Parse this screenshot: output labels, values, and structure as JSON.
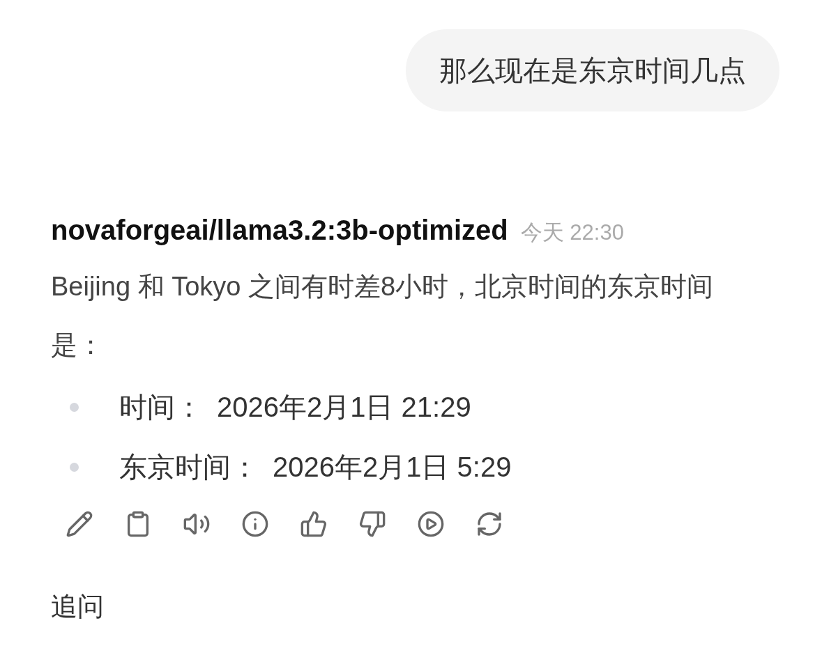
{
  "user_message": {
    "text": "那么现在是东京时间几点"
  },
  "reply": {
    "model": "novaforgeai/llama3.2:3b-optimized",
    "time": "今天 22:30",
    "paragraph": "Beijing 和 Tokyo 之间有时差8小时，北京时间的东京时间是：",
    "bullets": [
      {
        "label": "时间：",
        "value": "2026年2月1日 21:29"
      },
      {
        "label": "东京时间：",
        "value": "2026年2月1日 5:29"
      }
    ]
  },
  "follow_up": {
    "label": "追问"
  }
}
